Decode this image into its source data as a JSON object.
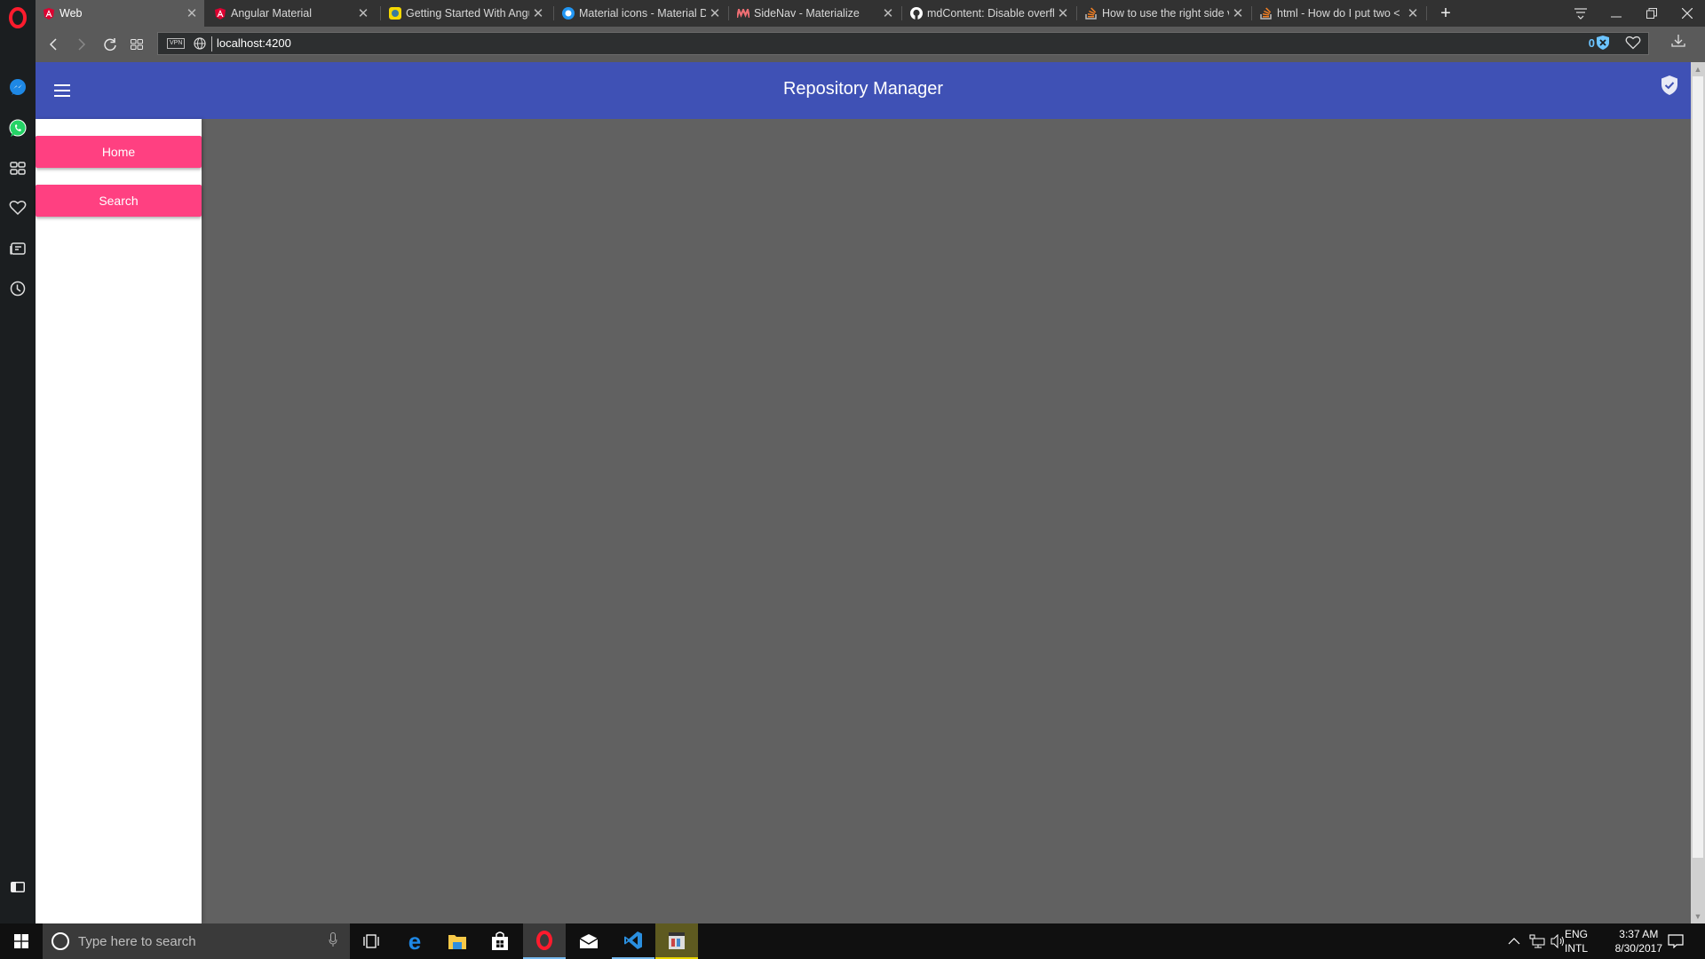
{
  "browser": {
    "tabs": [
      {
        "title": "Web",
        "favicon": "angular-icon",
        "active": true
      },
      {
        "title": "Angular Material",
        "favicon": "angular-icon",
        "active": false
      },
      {
        "title": "Getting Started With Angu",
        "favicon": "getting-started-icon",
        "active": false
      },
      {
        "title": "Material icons - Material D",
        "favicon": "material-icons-icon",
        "active": false
      },
      {
        "title": "SideNav - Materialize",
        "favicon": "materialize-icon",
        "active": false
      },
      {
        "title": "mdContent: Disable overfl",
        "favicon": "github-icon",
        "active": false
      },
      {
        "title": "How to use the right side v",
        "favicon": "stackoverflow-icon",
        "active": false
      },
      {
        "title": "html - How do I put two <",
        "favicon": "stackoverflow-icon",
        "active": false
      }
    ],
    "new_tab_label": "+",
    "url": "localhost:4200",
    "vpn_label": "VPN",
    "adblock_count": "0"
  },
  "app": {
    "title": "Repository Manager",
    "sidenav": {
      "buttons": [
        {
          "label": "Home"
        },
        {
          "label": "Search"
        }
      ]
    },
    "colors": {
      "primary": "#3f51b5",
      "accent": "#ff4081",
      "content_bg": "#616161"
    }
  },
  "taskbar": {
    "search_placeholder": "Type here to search",
    "language_top": "ENG",
    "language_bottom": "INTL",
    "time": "3:37 AM",
    "date": "8/30/2017"
  }
}
